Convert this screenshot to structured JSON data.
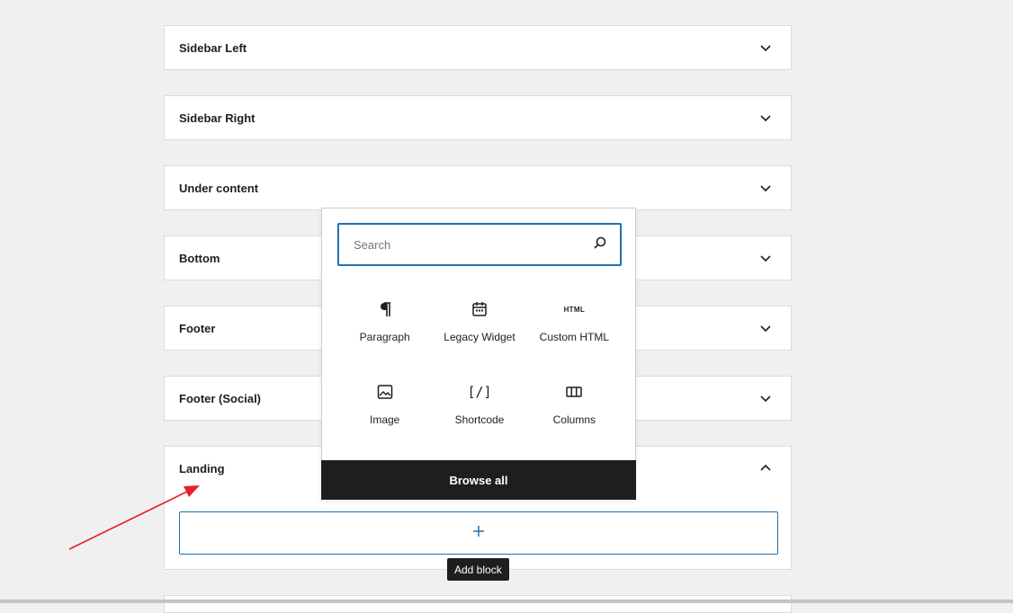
{
  "widget_areas": [
    {
      "title": "Sidebar Left",
      "expanded": false
    },
    {
      "title": "Sidebar Right",
      "expanded": false
    },
    {
      "title": "Under content",
      "expanded": false
    },
    {
      "title": "Bottom",
      "expanded": false
    },
    {
      "title": "Footer",
      "expanded": false
    },
    {
      "title": "Footer (Social)",
      "expanded": false
    },
    {
      "title": "Landing",
      "expanded": true
    }
  ],
  "add_block": {
    "tooltip": "Add block",
    "icon": "plus-icon"
  },
  "inserter": {
    "search_placeholder": "Search",
    "blocks": [
      {
        "label": "Paragraph",
        "icon": "paragraph-icon"
      },
      {
        "label": "Legacy Widget",
        "icon": "calendar-icon"
      },
      {
        "label": "Custom HTML",
        "icon": "html-icon",
        "icon_text": "HTML"
      },
      {
        "label": "Image",
        "icon": "image-icon"
      },
      {
        "label": "Shortcode",
        "icon": "shortcode-icon",
        "icon_text": "[/]"
      },
      {
        "label": "Columns",
        "icon": "columns-icon"
      }
    ],
    "browse_all": "Browse all"
  },
  "colors": {
    "accent": "#2271b1",
    "annotation_arrow": "#e8202a",
    "dark": "#1e1e1e"
  }
}
